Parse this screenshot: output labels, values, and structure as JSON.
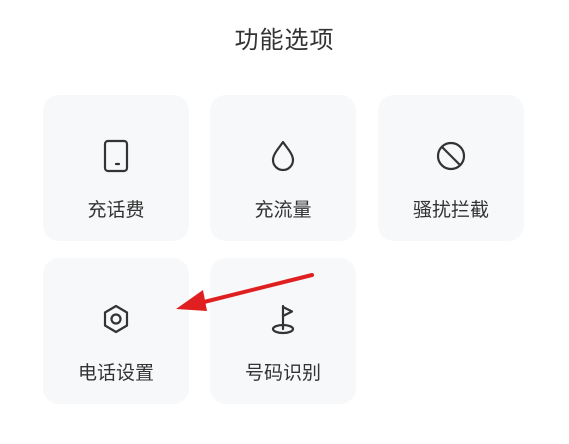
{
  "header": {
    "title": "功能选项"
  },
  "tiles": [
    {
      "label": "充话费",
      "icon": "phone-icon"
    },
    {
      "label": "充流量",
      "icon": "droplet-icon"
    },
    {
      "label": "骚扰拦截",
      "icon": "block-icon"
    },
    {
      "label": "电话设置",
      "icon": "gear-icon"
    },
    {
      "label": "号码识别",
      "icon": "flag-pin-icon"
    }
  ],
  "colors": {
    "tile_background": "#f6f8fa",
    "text": "#333333",
    "icon": "#333333",
    "annotation_arrow": "#e02020"
  }
}
